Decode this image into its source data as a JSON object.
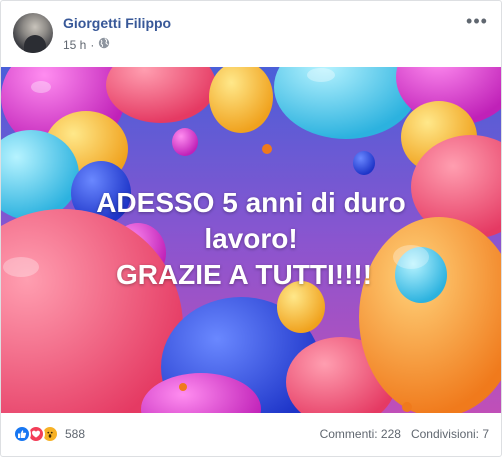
{
  "post": {
    "author": "Giorgetti Filippo",
    "time": "15 h",
    "separator": "·",
    "privacy_icon": "globe-icon",
    "more_icon": "more-options-icon",
    "more_glyph": "•••"
  },
  "photo": {
    "text_line1": "ADESSO 5 anni di duro",
    "text_line2": "lavoro!",
    "text_line3": "GRAZIE A TUTTI!!!!"
  },
  "footer": {
    "reaction_icons": [
      "like-icon",
      "love-icon",
      "wow-icon"
    ],
    "reaction_count": "588",
    "comments": "Commenti: 228",
    "shares": "Condivisioni: 7"
  },
  "colors": {
    "link": "#385898",
    "secondary_text": "#606770",
    "like": "#1877f2",
    "love": "#f33e58",
    "wow": "#f7b125"
  }
}
